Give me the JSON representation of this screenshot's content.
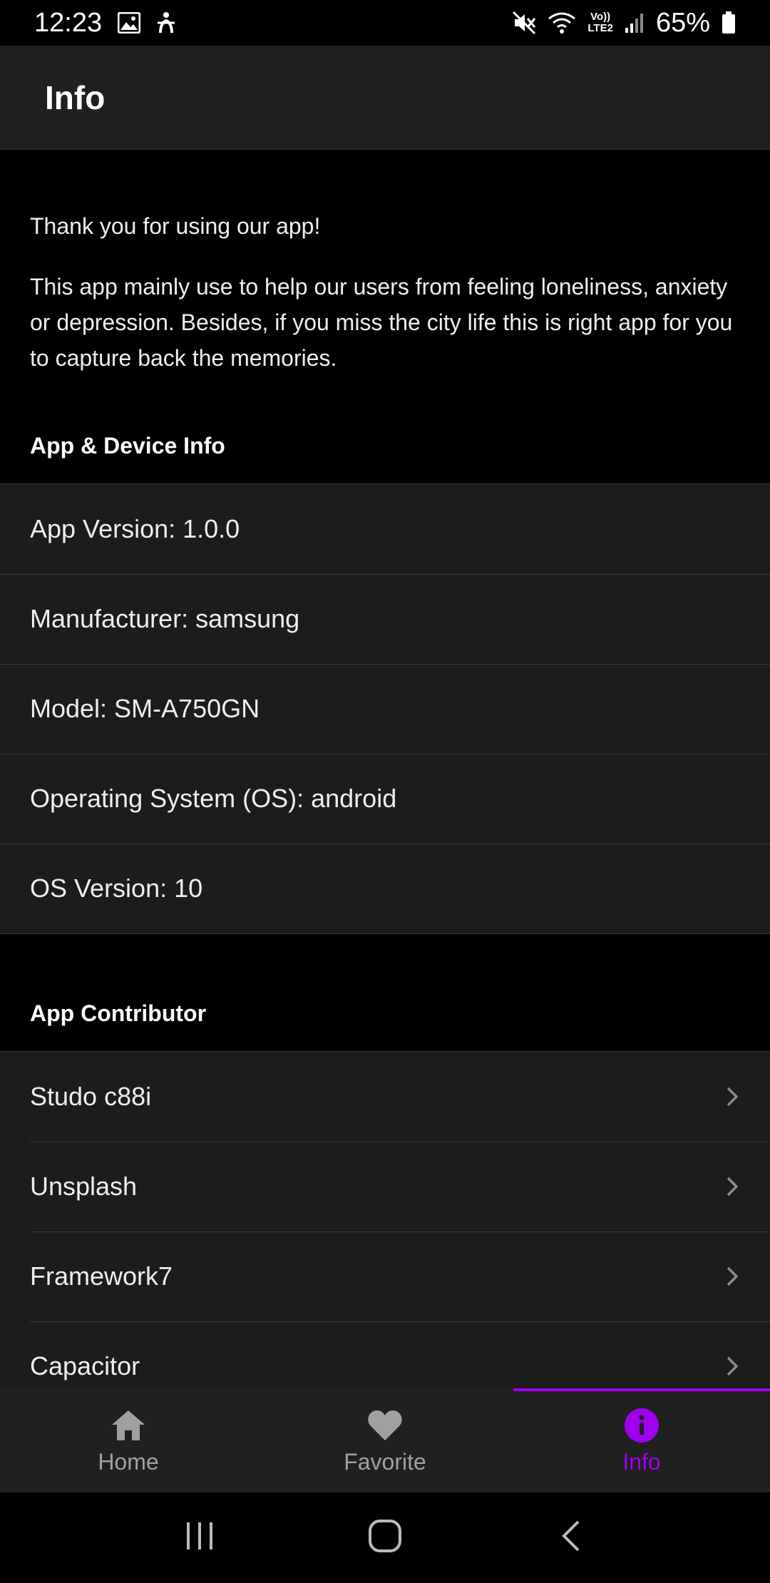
{
  "status_bar": {
    "time": "12:23",
    "battery": "65%",
    "network_label_top": "Vo))",
    "network_label_bottom": "LTE2"
  },
  "navbar": {
    "title": "Info"
  },
  "intro": {
    "thanks": "Thank you for using our app!",
    "description": "This app mainly use to help our users from feeling loneliness, anxiety or depression. Besides, if you miss the city life this is right app for you to capture back the memories."
  },
  "device_info": {
    "title": "App & Device Info",
    "items": [
      "App Version: 1.0.0",
      "Manufacturer: samsung",
      "Model: SM-A750GN",
      "Operating System (OS): android",
      "OS Version: 10"
    ]
  },
  "contributors": {
    "title": "App Contributor",
    "items": [
      "Studo c88i",
      "Unsplash",
      "Framework7",
      "Capacitor"
    ]
  },
  "tabbar": {
    "tabs": [
      {
        "label": "Home",
        "icon": "home-icon",
        "active": false
      },
      {
        "label": "Favorite",
        "icon": "heart-icon",
        "active": false
      },
      {
        "label": "Info",
        "icon": "info-icon",
        "active": true
      }
    ]
  },
  "colors": {
    "accent": "#a000f0",
    "bar_background": "#202020",
    "list_background": "#1c1c1c",
    "page_background": "#000000"
  }
}
